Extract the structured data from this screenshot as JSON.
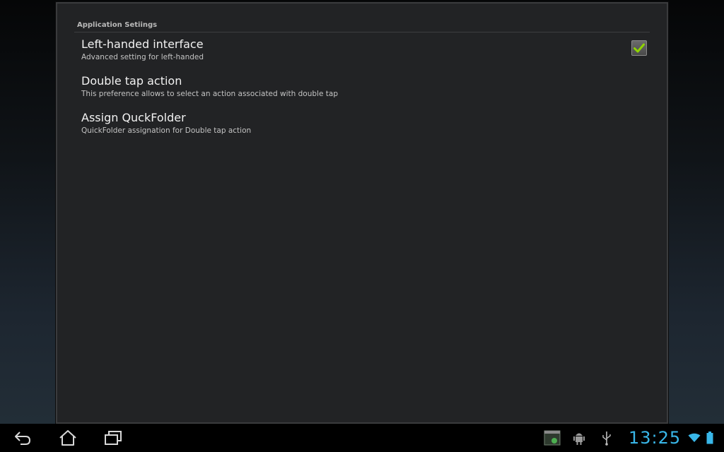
{
  "settings": {
    "category_title": "Application Setiings",
    "items": [
      {
        "title": "Left-handed interface",
        "summary": "Advanced setting for left-handed",
        "has_checkbox": true,
        "checked": true
      },
      {
        "title": "Double tap action",
        "summary": "This preference allows to select an action associated with double tap"
      },
      {
        "title": "Assign QuckFolder",
        "summary": "QuickFolder assignation for Double tap action"
      }
    ]
  },
  "navbar": {
    "buttons": [
      "back-icon",
      "home-icon",
      "recent-apps-icon"
    ]
  },
  "status": {
    "clock": "13:25",
    "icons": [
      "screenshot-notification-icon",
      "android-debug-icon",
      "usb-icon",
      "wifi-icon",
      "battery-icon"
    ],
    "accent_color": "#39b7e9",
    "check_color": "#8fd400"
  }
}
